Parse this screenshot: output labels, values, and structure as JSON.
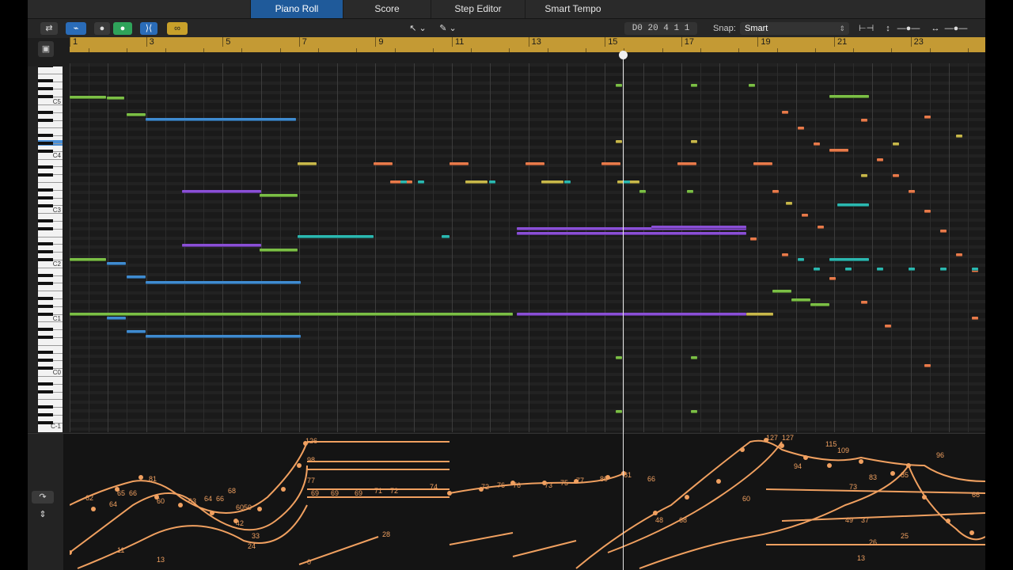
{
  "tabs": [
    "Piano Roll",
    "Score",
    "Step Editor",
    "Smart Tempo"
  ],
  "toolbar": {
    "position": "D0   20 4 1 1",
    "snap_label": "Snap:",
    "snap_value": "Smart"
  },
  "ruler": {
    "bars": [
      "1",
      "3",
      "5",
      "7",
      "9",
      "11",
      "13",
      "15",
      "17",
      "19",
      "21",
      "23"
    ]
  },
  "keyboard": {
    "labels": [
      "C5",
      "C4",
      "C3",
      "C2",
      "C1",
      "C0",
      "C-1"
    ]
  },
  "automation": {
    "labels": [
      "126",
      "98",
      "77",
      "69",
      "69",
      "81",
      "62",
      "65",
      "66",
      "64",
      "60",
      "68",
      "63",
      "64",
      "66",
      "60",
      "50",
      "42",
      "33",
      "24",
      "11",
      "13",
      "0",
      "28",
      "69",
      "71",
      "72",
      "74",
      "72",
      "76",
      "76",
      "73",
      "75",
      "77",
      "80",
      "81",
      "66",
      "48",
      "68",
      "60",
      "127",
      "127",
      "115",
      "109",
      "94",
      "73",
      "83",
      "85",
      "96",
      "66",
      "37",
      "26",
      "13",
      "25",
      "49"
    ]
  },
  "colors": {
    "accent": "#1f5a9a",
    "ruler": "#c49a34",
    "note_green": "#7bbf45",
    "note_blue": "#3f8bd0",
    "note_teal": "#2bb8b0",
    "note_purple": "#8a4fd6",
    "note_yellow": "#c8b84a",
    "note_orange": "#e87a4a",
    "automation": "#f0a060"
  }
}
